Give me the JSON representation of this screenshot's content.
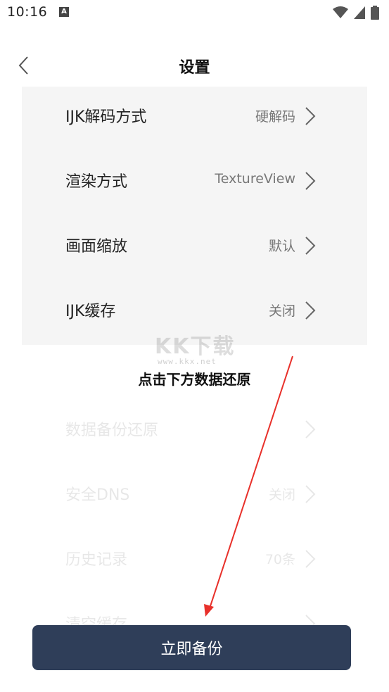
{
  "status_bar": {
    "time": "10:16",
    "notification_letter": "A"
  },
  "nav": {
    "title": "设置"
  },
  "settings": [
    {
      "label": "IJK解码方式",
      "value": "硬解码"
    },
    {
      "label": "渲染方式",
      "value": "TextureView"
    },
    {
      "label": "画面缩放",
      "value": "默认"
    },
    {
      "label": "IJK缓存",
      "value": "关闭"
    }
  ],
  "faded_settings": [
    {
      "label": "数据备份还原",
      "value": ""
    },
    {
      "label": "安全DNS",
      "value": "关闭"
    },
    {
      "label": "历史记录",
      "value": "70条"
    },
    {
      "label": "清空缓存",
      "value": ""
    }
  ],
  "hint": "点击下方数据还原",
  "watermark": {
    "logo": "KK下载",
    "url": "www.kkx.net"
  },
  "backup_button": "立即备份",
  "colors": {
    "panel": "#f5f5f5",
    "button": "#2f3e59",
    "arrow": "#e8302a"
  }
}
